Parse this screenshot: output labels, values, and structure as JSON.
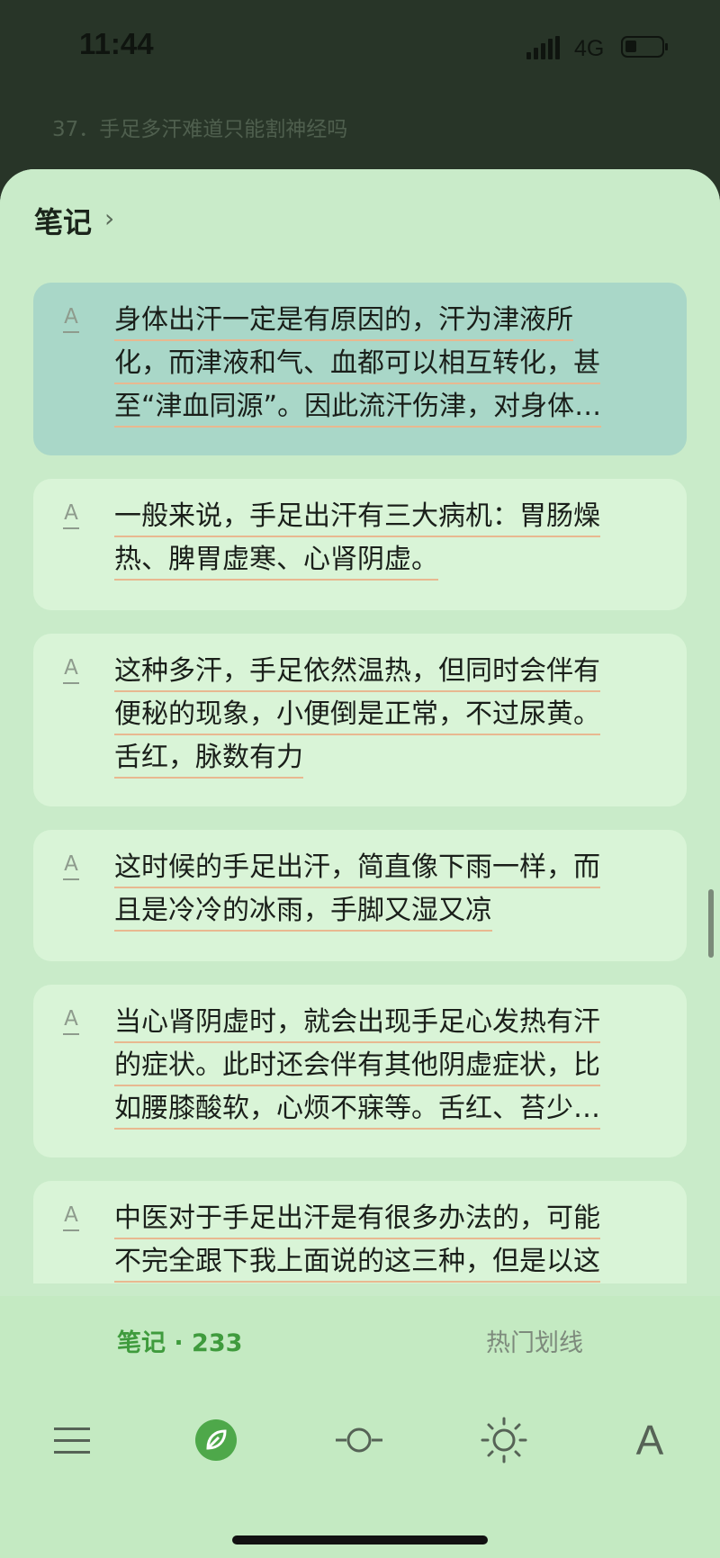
{
  "status_bar": {
    "time": "11:44",
    "network": "4G"
  },
  "chapter": {
    "title": "37．手足多汗难道只能割神经吗"
  },
  "sheet": {
    "title": "笔记",
    "chevron": "›"
  },
  "notes": [
    {
      "icon": "A",
      "selected": true,
      "lines": [
        "身体出汗一定是有原因的，汗为津液所",
        "化，而津液和气、血都可以相互转化，甚",
        "至“津血同源”。因此流汗伤津，对身体…"
      ]
    },
    {
      "icon": "A",
      "lines": [
        "一般来说，手足出汗有三大病机：胃肠燥",
        "热、脾胃虚寒、心肾阴虚。"
      ]
    },
    {
      "icon": "A",
      "lines": [
        "这种多汗，手足依然温热，但同时会伴有",
        "便秘的现象，小便倒是正常，不过尿黄。",
        "舌红，脉数有力"
      ]
    },
    {
      "icon": "A",
      "lines": [
        "这时候的手足出汗，简直像下雨一样，而",
        "且是冷冷的冰雨，手脚又湿又凉"
      ]
    },
    {
      "icon": "A",
      "lines": [
        "当心肾阴虚时，就会出现手足心发热有汗",
        "的症状。此时还会伴有其他阴虚症状，比",
        "如腰膝酸软，心烦不寐等。舌红、苔少…"
      ]
    },
    {
      "icon": "A",
      "lines": [
        "中医对于手足出汗是有很多办法的，可能",
        "不完全跟下我上面说的这三种，但是以这"
      ]
    }
  ],
  "tabs": {
    "notes": "笔记 · 233",
    "hot": "热门划线"
  },
  "toolbar": {
    "font_label": "A",
    "icons": [
      "menu-icon",
      "leaf-icon",
      "progress-icon",
      "brightness-icon",
      "font-icon"
    ]
  },
  "colors": {
    "accent": "#4ea84a",
    "selected_card": "#a9d7c8",
    "card": "#d9f4d7",
    "underline": "#e8b890"
  }
}
